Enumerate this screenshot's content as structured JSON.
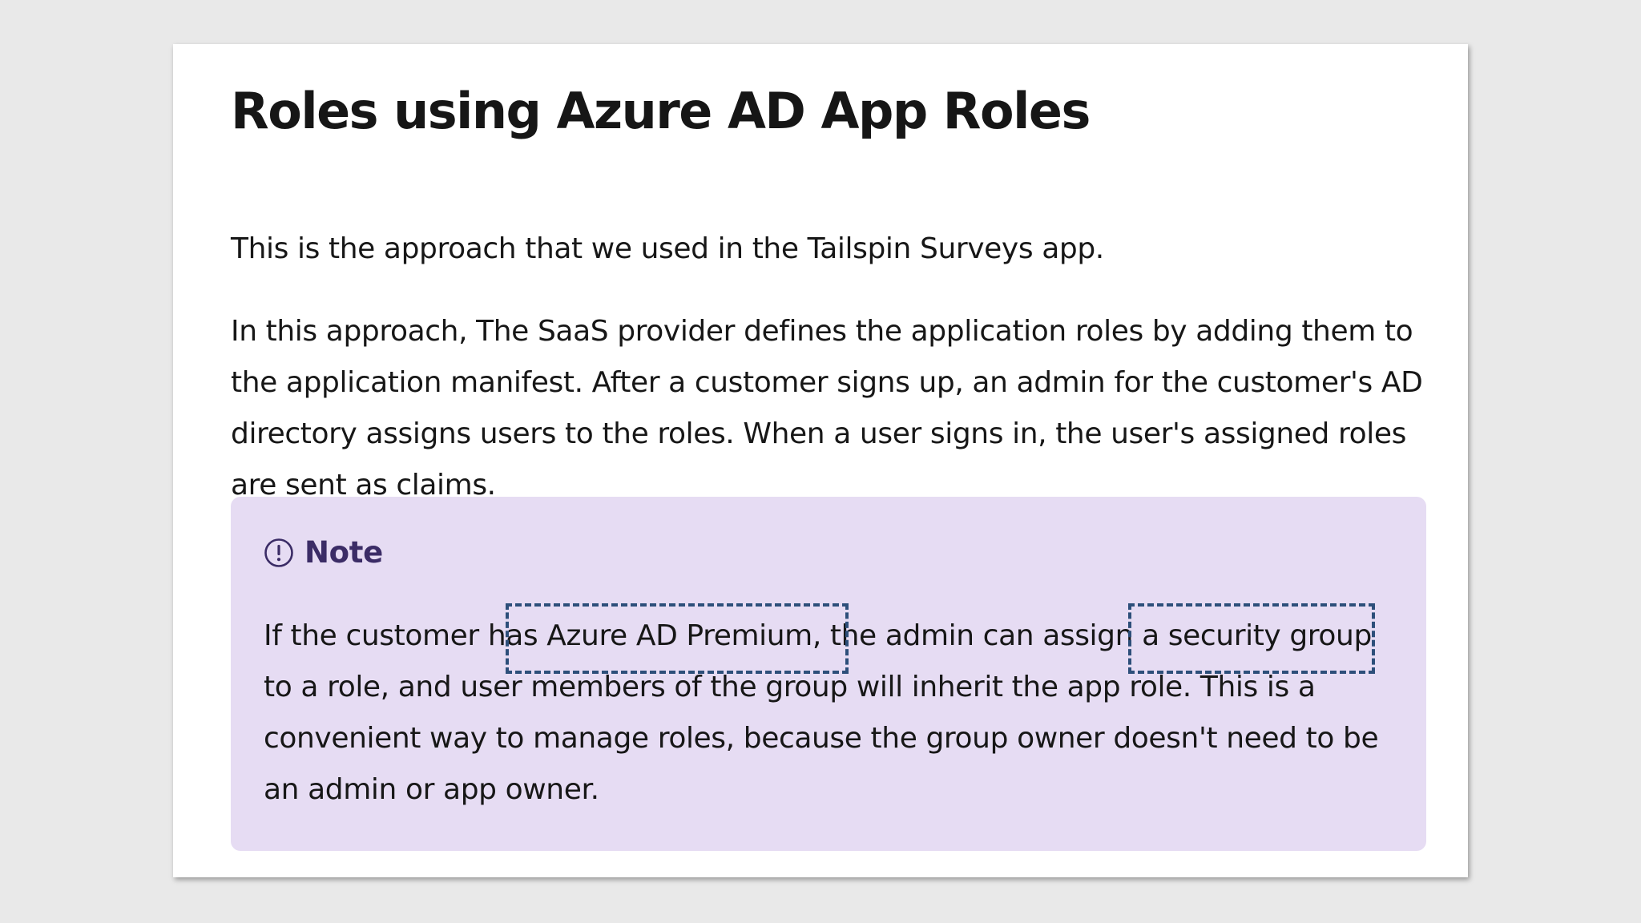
{
  "title": "Roles using Azure AD App Roles",
  "intro": "This is the approach that we used in the Tailspin Surveys app.",
  "description_lines": [
    "In this approach, The SaaS provider defines the application roles by adding them to",
    "the application manifest. After a customer signs up, an admin for the customer's AD",
    "directory assigns users to the roles. When a user signs in, the user's assigned roles",
    "are sent as claims."
  ],
  "note": {
    "icon": "info-circle-icon",
    "label": "Note",
    "lines": [
      "If the customer has Azure AD Premium, the admin can assign a security group",
      "to a role, and user members of the group will inherit the app role. This is a",
      "convenient way to manage roles, because the group owner doesn't need to be",
      "an admin or app owner."
    ]
  },
  "colors": {
    "page_background": "#e9e9e9",
    "card_background": "#ffffff",
    "note_background": "#e6dcf3",
    "note_accent": "#3b2c66",
    "highlight_border": "#2d4f7a"
  }
}
